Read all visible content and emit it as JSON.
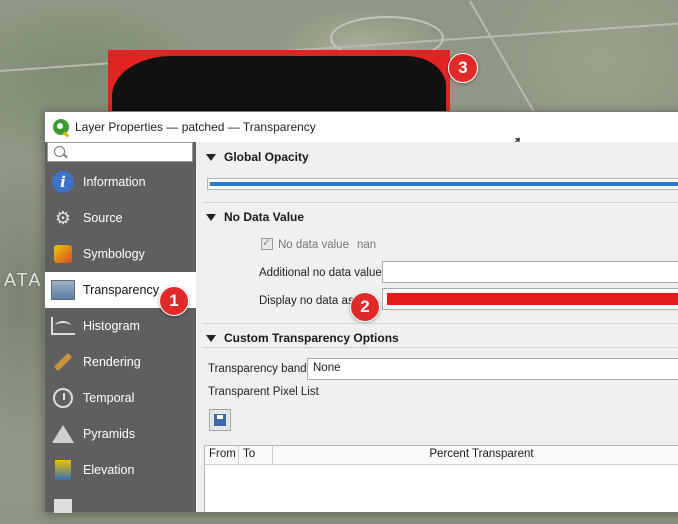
{
  "map": {
    "label": "ATA"
  },
  "callouts": [
    "1",
    "2",
    "3"
  ],
  "dialog": {
    "title": "Layer Properties — patched — Transparency",
    "sidebar": {
      "search_placeholder": "",
      "items": [
        {
          "label": "Information",
          "icon": "info-icon"
        },
        {
          "label": "Source",
          "icon": "source-icon"
        },
        {
          "label": "Symbology",
          "icon": "symbology-icon"
        },
        {
          "label": "Transparency",
          "icon": "transparency-icon",
          "selected": true
        },
        {
          "label": "Histogram",
          "icon": "histogram-icon"
        },
        {
          "label": "Rendering",
          "icon": "rendering-icon"
        },
        {
          "label": "Temporal",
          "icon": "temporal-icon"
        },
        {
          "label": "Pyramids",
          "icon": "pyramids-icon"
        },
        {
          "label": "Elevation",
          "icon": "elevation-icon"
        }
      ]
    },
    "global_opacity": {
      "header": "Global Opacity",
      "value_fraction": 1.0
    },
    "no_data": {
      "header": "No Data Value",
      "checkbox_label": "No data value",
      "checkbox_value": "nan",
      "checked": true,
      "additional_label": "Additional no data value",
      "additional_value": "",
      "display_label": "Display no data as",
      "display_color": "#e31b1b"
    },
    "custom": {
      "header": "Custom Transparency Options",
      "band_label": "Transparency band",
      "band_value": "None",
      "pixel_list_label": "Transparent Pixel List",
      "columns": [
        "From",
        "To",
        "Percent Transparent"
      ]
    }
  }
}
